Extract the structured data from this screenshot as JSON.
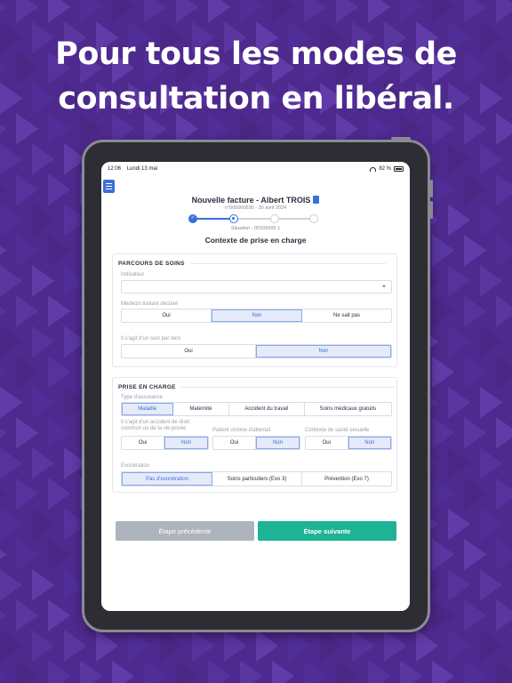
{
  "headline": {
    "line1": "Pour tous les modes de",
    "line2": "consultation en libéral."
  },
  "colors": {
    "background": "#4e2a8e",
    "accent_blue": "#3b6fd8",
    "accent_green": "#1db394",
    "disabled_gray": "#aeb4bd"
  },
  "status_bar": {
    "time": "12:06",
    "date": "Lundi 13 mai",
    "battery": "82 %"
  },
  "header": {
    "menu_icon": "hamburger-icon",
    "title": "Nouvelle facture - Albert TROIS",
    "title_icon": "document-icon",
    "invoice_ref": "n°000000595 - 30 avril 2024",
    "situation": "Situation - 00105695 1",
    "section_title": "Contexte de prise en charge"
  },
  "stepper": {
    "total_steps": 4,
    "completed_steps": 1,
    "current_step": 2
  },
  "parcours": {
    "heading": "PARCOURS DE SOINS",
    "indicateur_label": "Indicateur",
    "indicateur_value": "",
    "medecin_label": "Médecin traitant déclaré",
    "medecin_options": [
      "Oui",
      "Non",
      "Ne sait pas"
    ],
    "medecin_selected": "Non",
    "tiers_label": "Il s'agit d'un soin par tiers",
    "tiers_options": [
      "Oui",
      "Non"
    ],
    "tiers_selected": "Non"
  },
  "prise_en_charge": {
    "heading": "PRISE EN CHARGE",
    "assurance_label": "Type d'assurance",
    "assurance_options": [
      "Maladie",
      "Maternité",
      "Accident du travail",
      "Soins médicaux gratuits"
    ],
    "assurance_selected": "Maladie",
    "accident_label": "Il s'agit d'un accident de droit commun ou de la vie privée",
    "accident_options": [
      "Oui",
      "Non"
    ],
    "accident_selected": "Non",
    "attentat_label": "Patient victime d'attentat",
    "attentat_options": [
      "Oui",
      "Non"
    ],
    "attentat_selected": "Non",
    "sexuelle_label": "Contexte de santé sexuelle",
    "sexuelle_options": [
      "Oui",
      "Non"
    ],
    "sexuelle_selected": "Non",
    "exoneration_label": "Exonération",
    "exoneration_options": [
      "Pas d'exonération",
      "Soins particuliers (Exo 3)",
      "Prévention (Exo 7)"
    ],
    "exoneration_selected": "Pas d'exonération"
  },
  "footer": {
    "prev_label": "Étape précédente",
    "next_label": "Étape suivante"
  }
}
